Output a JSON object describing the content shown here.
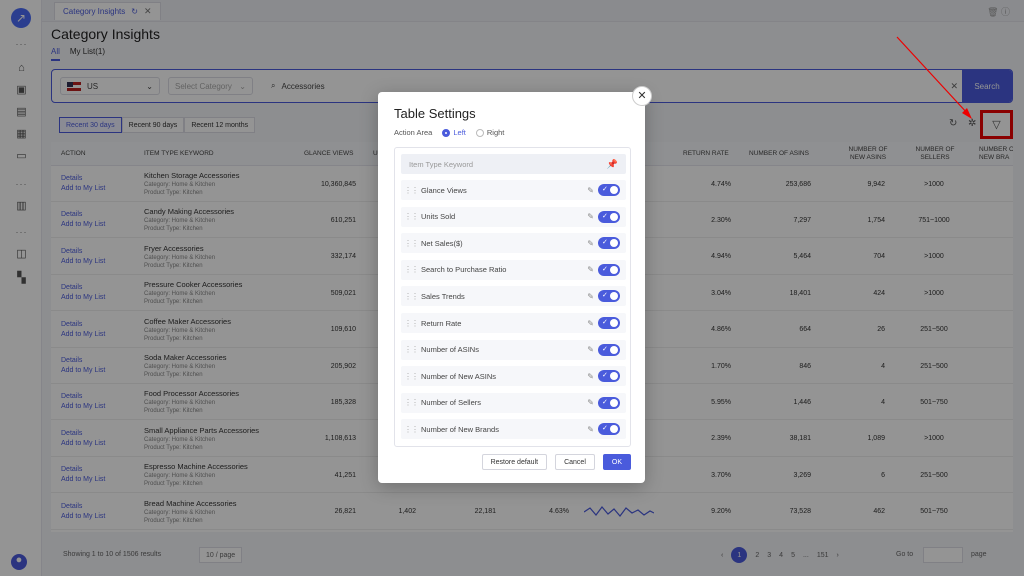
{
  "tab": {
    "label": "Category Insights"
  },
  "page": {
    "title": "Category Insights",
    "subtabs": [
      "All",
      "My List(1)"
    ]
  },
  "search": {
    "marketplace": "US",
    "category_placeholder": "Select Category",
    "keyword": "Accessories",
    "button": "Search"
  },
  "ranges": [
    "Recent 30 days",
    "Recent 90 days",
    "Recent 12 months"
  ],
  "columns": [
    "ACTION",
    "ITEM TYPE KEYWORD",
    "GLANCE VIEWS",
    "U",
    "RETURN RATE",
    "NUMBER OF ASINS",
    "NUMBER OF NEW ASINS",
    "NUMBER OF SELLERS",
    "NUMBER OF NEW BRA"
  ],
  "row_actions": {
    "details": "Details",
    "add": "Add to My List"
  },
  "rows": [
    {
      "kw": "Kitchen Storage Accessories",
      "cat": "Category: Home & Kitchen",
      "pt": "Product Type: Kitchen",
      "gv": "10,360,845",
      "rr": "4.74%",
      "asins": "253,686",
      "new": "9,942",
      "sellers": ">1000"
    },
    {
      "kw": "Candy Making Accessories",
      "cat": "Category: Home & Kitchen",
      "pt": "Product Type: Kitchen",
      "gv": "610,251",
      "rr": "2.30%",
      "asins": "7,297",
      "new": "1,754",
      "sellers": "751~1000"
    },
    {
      "kw": "Fryer Accessories",
      "cat": "Category: Home & Kitchen",
      "pt": "Product Type: Kitchen",
      "gv": "332,174",
      "rr": "4.94%",
      "asins": "5,464",
      "new": "704",
      "sellers": ">1000"
    },
    {
      "kw": "Pressure Cooker Accessories",
      "cat": "Category: Home & Kitchen",
      "pt": "Product Type: Kitchen",
      "gv": "509,021",
      "rr": "3.04%",
      "asins": "18,401",
      "new": "424",
      "sellers": ">1000"
    },
    {
      "kw": "Coffee Maker Accessories",
      "cat": "Category: Home & Kitchen",
      "pt": "Product Type: Kitchen",
      "gv": "109,610",
      "rr": "4.86%",
      "asins": "664",
      "new": "26",
      "sellers": "251~500"
    },
    {
      "kw": "Soda Maker Accessories",
      "cat": "Category: Home & Kitchen",
      "pt": "Product Type: Kitchen",
      "gv": "205,902",
      "rr": "1.70%",
      "asins": "846",
      "new": "4",
      "sellers": "251~500"
    },
    {
      "kw": "Food Processor Accessories",
      "cat": "Category: Home & Kitchen",
      "pt": "Product Type: Kitchen",
      "gv": "185,328",
      "rr": "5.95%",
      "asins": "1,446",
      "new": "4",
      "sellers": "501~750"
    },
    {
      "kw": "Small Appliance Parts Accessories",
      "cat": "Category: Home & Kitchen",
      "pt": "Product Type: Kitchen",
      "gv": "1,108,613",
      "rr": "2.39%",
      "asins": "38,181",
      "new": "1,089",
      "sellers": ">1000"
    },
    {
      "kw": "Espresso Machine Accessories",
      "cat": "Category: Home & Kitchen",
      "pt": "Product Type: Kitchen",
      "gv": "41,251",
      "rr": "3.70%",
      "asins": "3,269",
      "new": "6",
      "sellers": "251~500"
    },
    {
      "kw": "Bread Machine Accessories",
      "cat": "Category: Home & Kitchen",
      "pt": "Product Type: Kitchen",
      "gv": "26,821",
      "u": "1,402",
      "ns": "22,181",
      "sp": "4.63%",
      "rr": "9.20%",
      "asins": "73,528",
      "new": "462",
      "sellers": "501~750"
    }
  ],
  "pager": {
    "info": "Showing 1 to 10 of 1506 results",
    "per_page": "10 / page",
    "pages": [
      "1",
      "2",
      "3",
      "4",
      "5",
      "...",
      "151"
    ],
    "goto": "Go to",
    "page_label": "page"
  },
  "modal": {
    "title": "Table Settings",
    "action_area_label": "Action Area",
    "left": "Left",
    "right": "Right",
    "pinned_item": "Item Type Keyword",
    "items": [
      "Glance Views",
      "Units Sold",
      "Net Sales($)",
      "Search to Purchase Ratio",
      "Sales Trends",
      "Return Rate",
      "Number of ASINs",
      "Number of New ASINs",
      "Number of Sellers",
      "Number of New Brands"
    ],
    "restore": "Restore default",
    "cancel": "Cancel",
    "ok": "OK"
  },
  "colors": {
    "accent": "#4a5bdc",
    "highlight": "#ee0000"
  }
}
